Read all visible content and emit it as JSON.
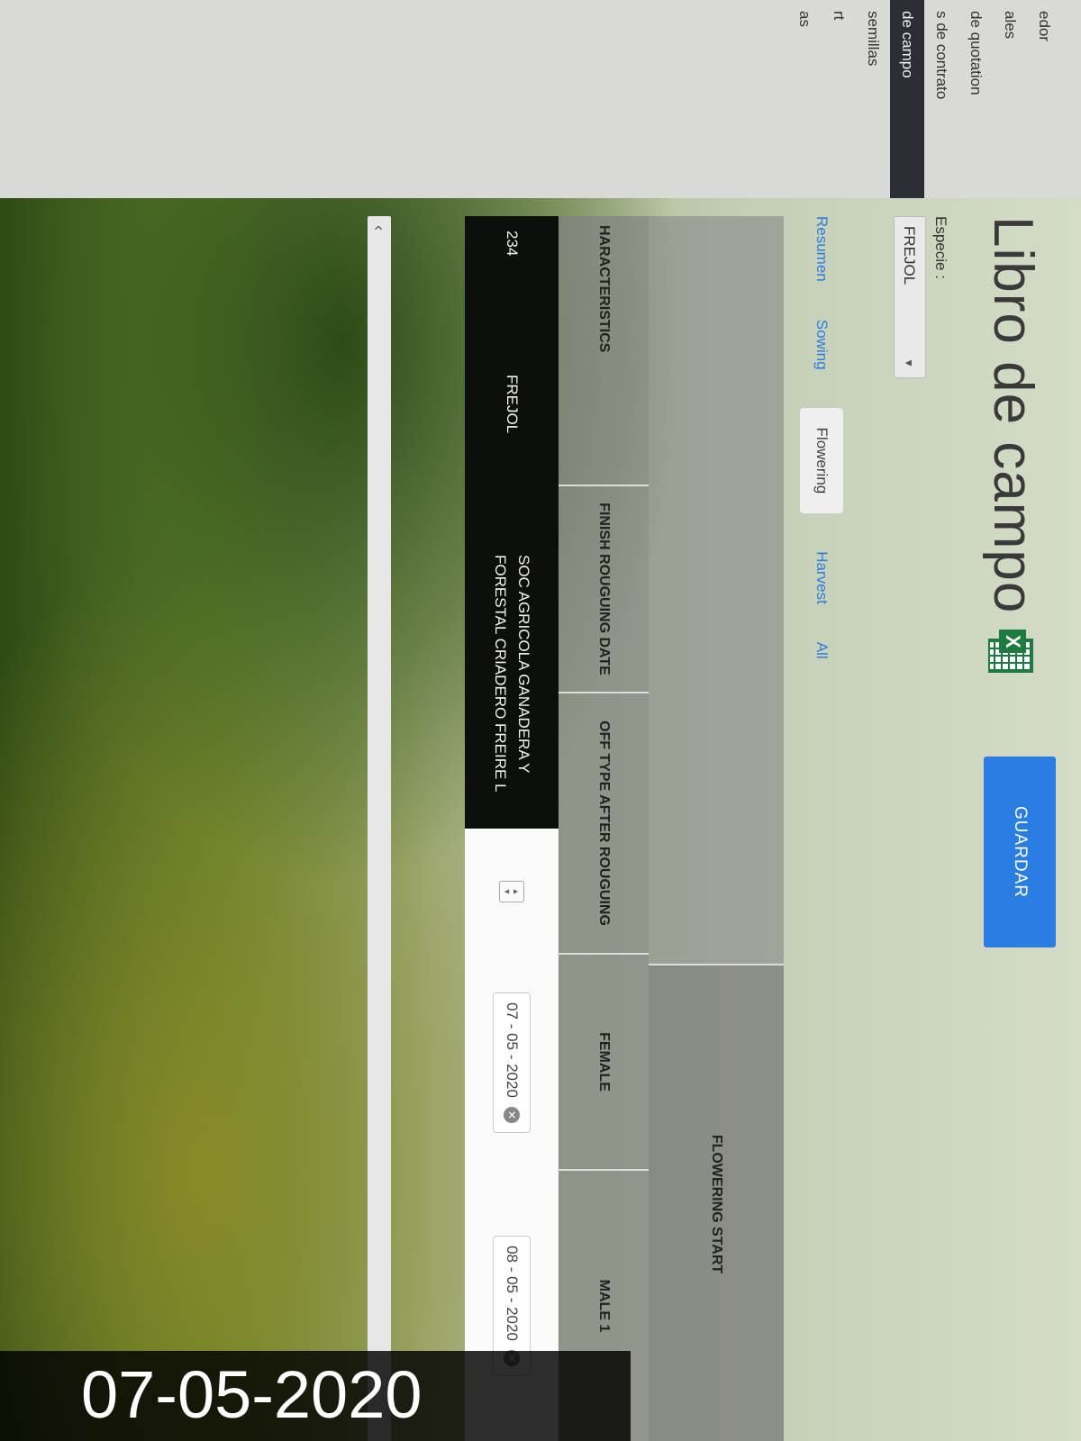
{
  "sidebar": {
    "items": [
      {
        "label": "edor"
      },
      {
        "label": "ales"
      },
      {
        "label": "de quotation"
      },
      {
        "label": "s de contrato"
      },
      {
        "label": "de campo",
        "active": true
      },
      {
        "label": "semillas"
      },
      {
        "label": "rt"
      },
      {
        "label": "as"
      }
    ]
  },
  "header": {
    "title": "Libro de campo",
    "save_label": "GUARDAR",
    "excel_icon": "excel-icon"
  },
  "filters": {
    "species_label": "Especie :",
    "species_value": "FREJOL"
  },
  "tabs": [
    {
      "label": "Resumen"
    },
    {
      "label": "Sowing"
    },
    {
      "label": "Flowering",
      "active": true
    },
    {
      "label": "Harvest"
    },
    {
      "label": "All"
    }
  ],
  "table": {
    "group_header": "FLOWERING START",
    "columns": [
      "HARACTERISTICS",
      "FINISH ROUGUING DATE",
      "OFF TYPE AFTER ROUGUING",
      "FEMALE",
      "MALE 1"
    ],
    "row": {
      "id": "234",
      "species": "FREJOL",
      "company": "SOC AGRICOLA GANADERA Y FORESTAL CRIADERO FREIRE L",
      "female_date": "07 - 05 - 2020",
      "male1_date": "08 - 05 - 2020"
    }
  },
  "timestamp": "07-05-2020"
}
